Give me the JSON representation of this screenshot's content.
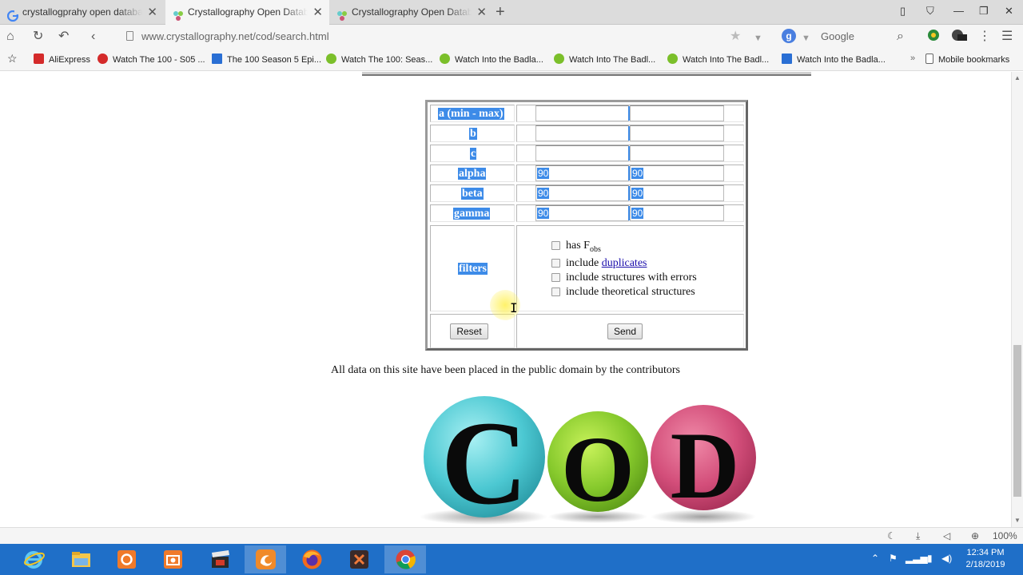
{
  "tabs": [
    {
      "title": "crystallogprahy open database",
      "active": false
    },
    {
      "title": "Crystallography Open Database",
      "active": true
    },
    {
      "title": "Crystallography Open Database",
      "active": false
    }
  ],
  "address": {
    "url": "www.crystallography.net/cod/search.html",
    "search_engine_badge": "g",
    "search_placeholder": "Google"
  },
  "bookmarks": [
    {
      "label": "AliExpress",
      "color": "#d42a2a"
    },
    {
      "label": "Watch The 100 - S05 ...",
      "color": "#d42a2a"
    },
    {
      "label": "The 100 Season 5 Epi...",
      "color": "#2a6fd4"
    },
    {
      "label": "Watch The 100: Seas...",
      "color": "#7bbf2a"
    },
    {
      "label": "Watch Into the Badla...",
      "color": "#7bbf2a"
    },
    {
      "label": "Watch Into The Badl...",
      "color": "#7bbf2a"
    },
    {
      "label": "Watch Into The Badl...",
      "color": "#7bbf2a"
    },
    {
      "label": "Watch Into the Badla...",
      "color": "#2a6fd4"
    }
  ],
  "bookmarks_more": "»",
  "mobile_bookmarks": "Mobile bookmarks",
  "form": {
    "rows": [
      {
        "label": "a (min - max)",
        "min": "",
        "max": ""
      },
      {
        "label": "b",
        "min": "",
        "max": ""
      },
      {
        "label": "c",
        "min": "",
        "max": ""
      },
      {
        "label": "alpha",
        "min": "90",
        "max": "90"
      },
      {
        "label": "beta",
        "min": "90",
        "max": "90"
      },
      {
        "label": "gamma",
        "min": "90",
        "max": "90"
      }
    ],
    "filters_label": "filters",
    "filter_options": {
      "has_fobs_prefix": "has F",
      "has_fobs_sub": "obs",
      "duplicates_prefix": "include ",
      "duplicates_link": "duplicates",
      "errors": "include structures with errors",
      "theoretical": "include theoretical structures"
    },
    "reset_label": "Reset",
    "send_label": "Send"
  },
  "footer_text": "All data on this site have been placed in the public domain by the contributors",
  "logo": {
    "letters": [
      "C",
      "O",
      "D"
    ]
  },
  "status": {
    "zoom": "100%"
  },
  "taskbar": {
    "clock_time": "12:34 PM",
    "clock_date": "2/18/2019"
  }
}
